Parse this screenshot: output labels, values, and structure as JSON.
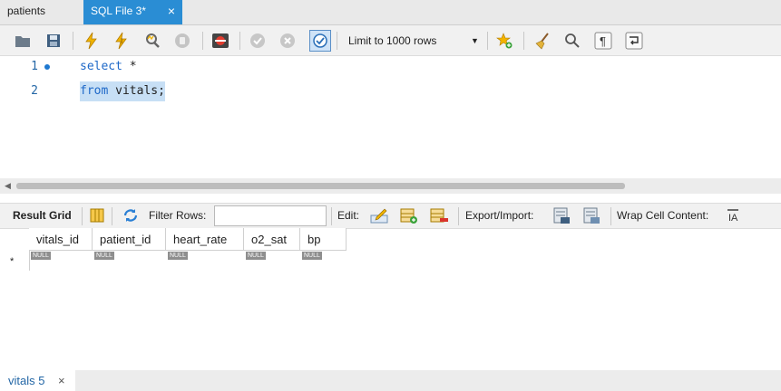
{
  "tabs": [
    {
      "label": "patients"
    },
    {
      "label": "SQL File 3*",
      "close": "×"
    }
  ],
  "toolbar": {
    "limit_label": "Limit to 1000 rows",
    "limit_arrow": "▼"
  },
  "editor": {
    "lines": [
      {
        "num": "1",
        "text_kw": "select",
        "text_rest": " *"
      },
      {
        "num": "2",
        "text_kw": "from",
        "text_rest": " vitals;"
      }
    ]
  },
  "result_toolbar": {
    "result_grid": "Result Grid",
    "filter_rows": "Filter Rows:",
    "edit": "Edit:",
    "export_import": "Export/Import:",
    "wrap_cell": "Wrap Cell Content:"
  },
  "grid": {
    "columns": [
      "vitals_id",
      "patient_id",
      "heart_rate",
      "o2_sat",
      "bp"
    ],
    "null_text": "NULL",
    "new_row_marker": "*"
  },
  "bottom": {
    "tab_label": "vitals 5",
    "close": "×"
  },
  "colors": {
    "accent": "#2a8dd4",
    "keyword": "#1e68c8",
    "selection": "#c7dff5"
  }
}
